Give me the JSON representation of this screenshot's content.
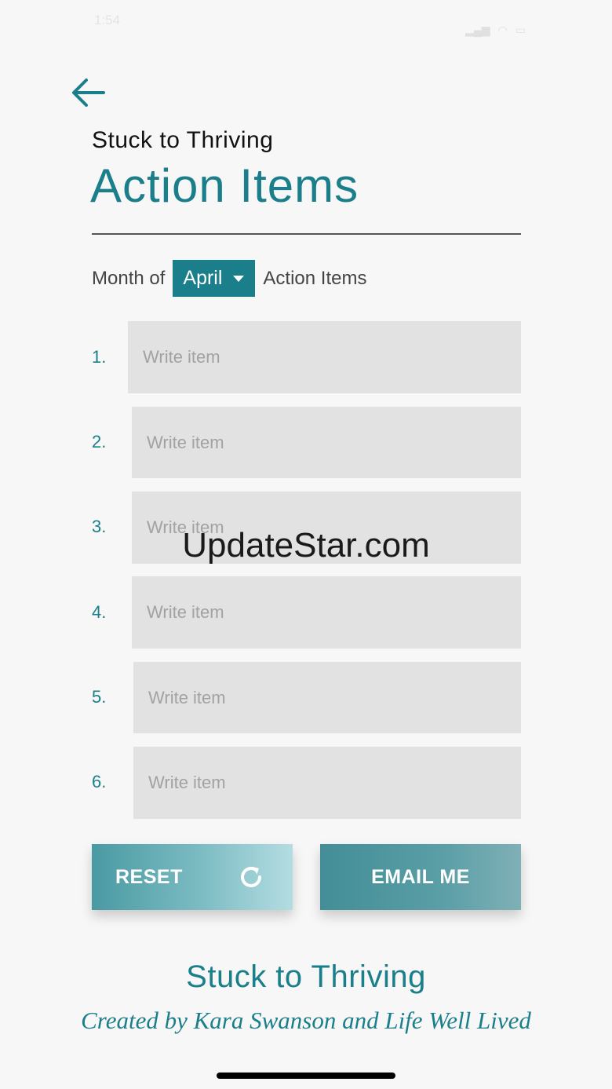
{
  "status_bar": {
    "time": "1:54",
    "icons": [
      "signal-icon",
      "wifi-icon",
      "battery-icon"
    ]
  },
  "header": {
    "subtitle": "Stuck to Thriving",
    "title": "Action Items",
    "back_icon": "arrow-left-icon"
  },
  "month": {
    "prefix": "Month of",
    "selected": "April",
    "suffix": "Action Items"
  },
  "items": [
    {
      "number": "1.",
      "placeholder": "Write item",
      "value": ""
    },
    {
      "number": "2.",
      "placeholder": "Write item",
      "value": ""
    },
    {
      "number": "3.",
      "placeholder": "Write item",
      "value": ""
    },
    {
      "number": "4.",
      "placeholder": "Write item",
      "value": ""
    },
    {
      "number": "5.",
      "placeholder": "Write item",
      "value": ""
    },
    {
      "number": "6.",
      "placeholder": "Write item",
      "value": ""
    }
  ],
  "buttons": {
    "reset": "RESET",
    "email": "EMAIL ME"
  },
  "footer": {
    "title": "Stuck to Thriving",
    "credit": "Created by Kara Swanson and Life Well Lived"
  },
  "watermark": "UpdateStar.com",
  "colors": {
    "accent": "#1a7f8a",
    "field_bg": "#e2e2e2",
    "page_bg": "#f7f7f7"
  }
}
